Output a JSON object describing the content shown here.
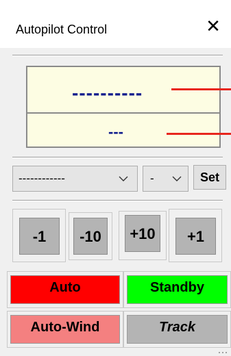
{
  "window": {
    "title": "Autopilot Control",
    "close_glyph": "✕"
  },
  "display": {
    "heading_value": "----------",
    "secondary_value": "---",
    "pointer_color": "#e8261d"
  },
  "controls": {
    "mode_select": {
      "value": "------------"
    },
    "direction_select": {
      "value": "-"
    },
    "set_label": "Set"
  },
  "steps": [
    {
      "label": "-1"
    },
    {
      "label": "-10"
    },
    {
      "label": "+10"
    },
    {
      "label": "+1"
    }
  ],
  "modes": [
    {
      "label": "Auto",
      "color": "#ff0000"
    },
    {
      "label": "Standby",
      "color": "#00ff00"
    },
    {
      "label": "Auto-Wind",
      "color": "#f48080"
    },
    {
      "label": "Track",
      "color": "#b4b4b4"
    }
  ],
  "icons": {
    "close": "close-icon",
    "dropdown": "chevron-down-icon",
    "grip": "resize-grip-icon"
  }
}
